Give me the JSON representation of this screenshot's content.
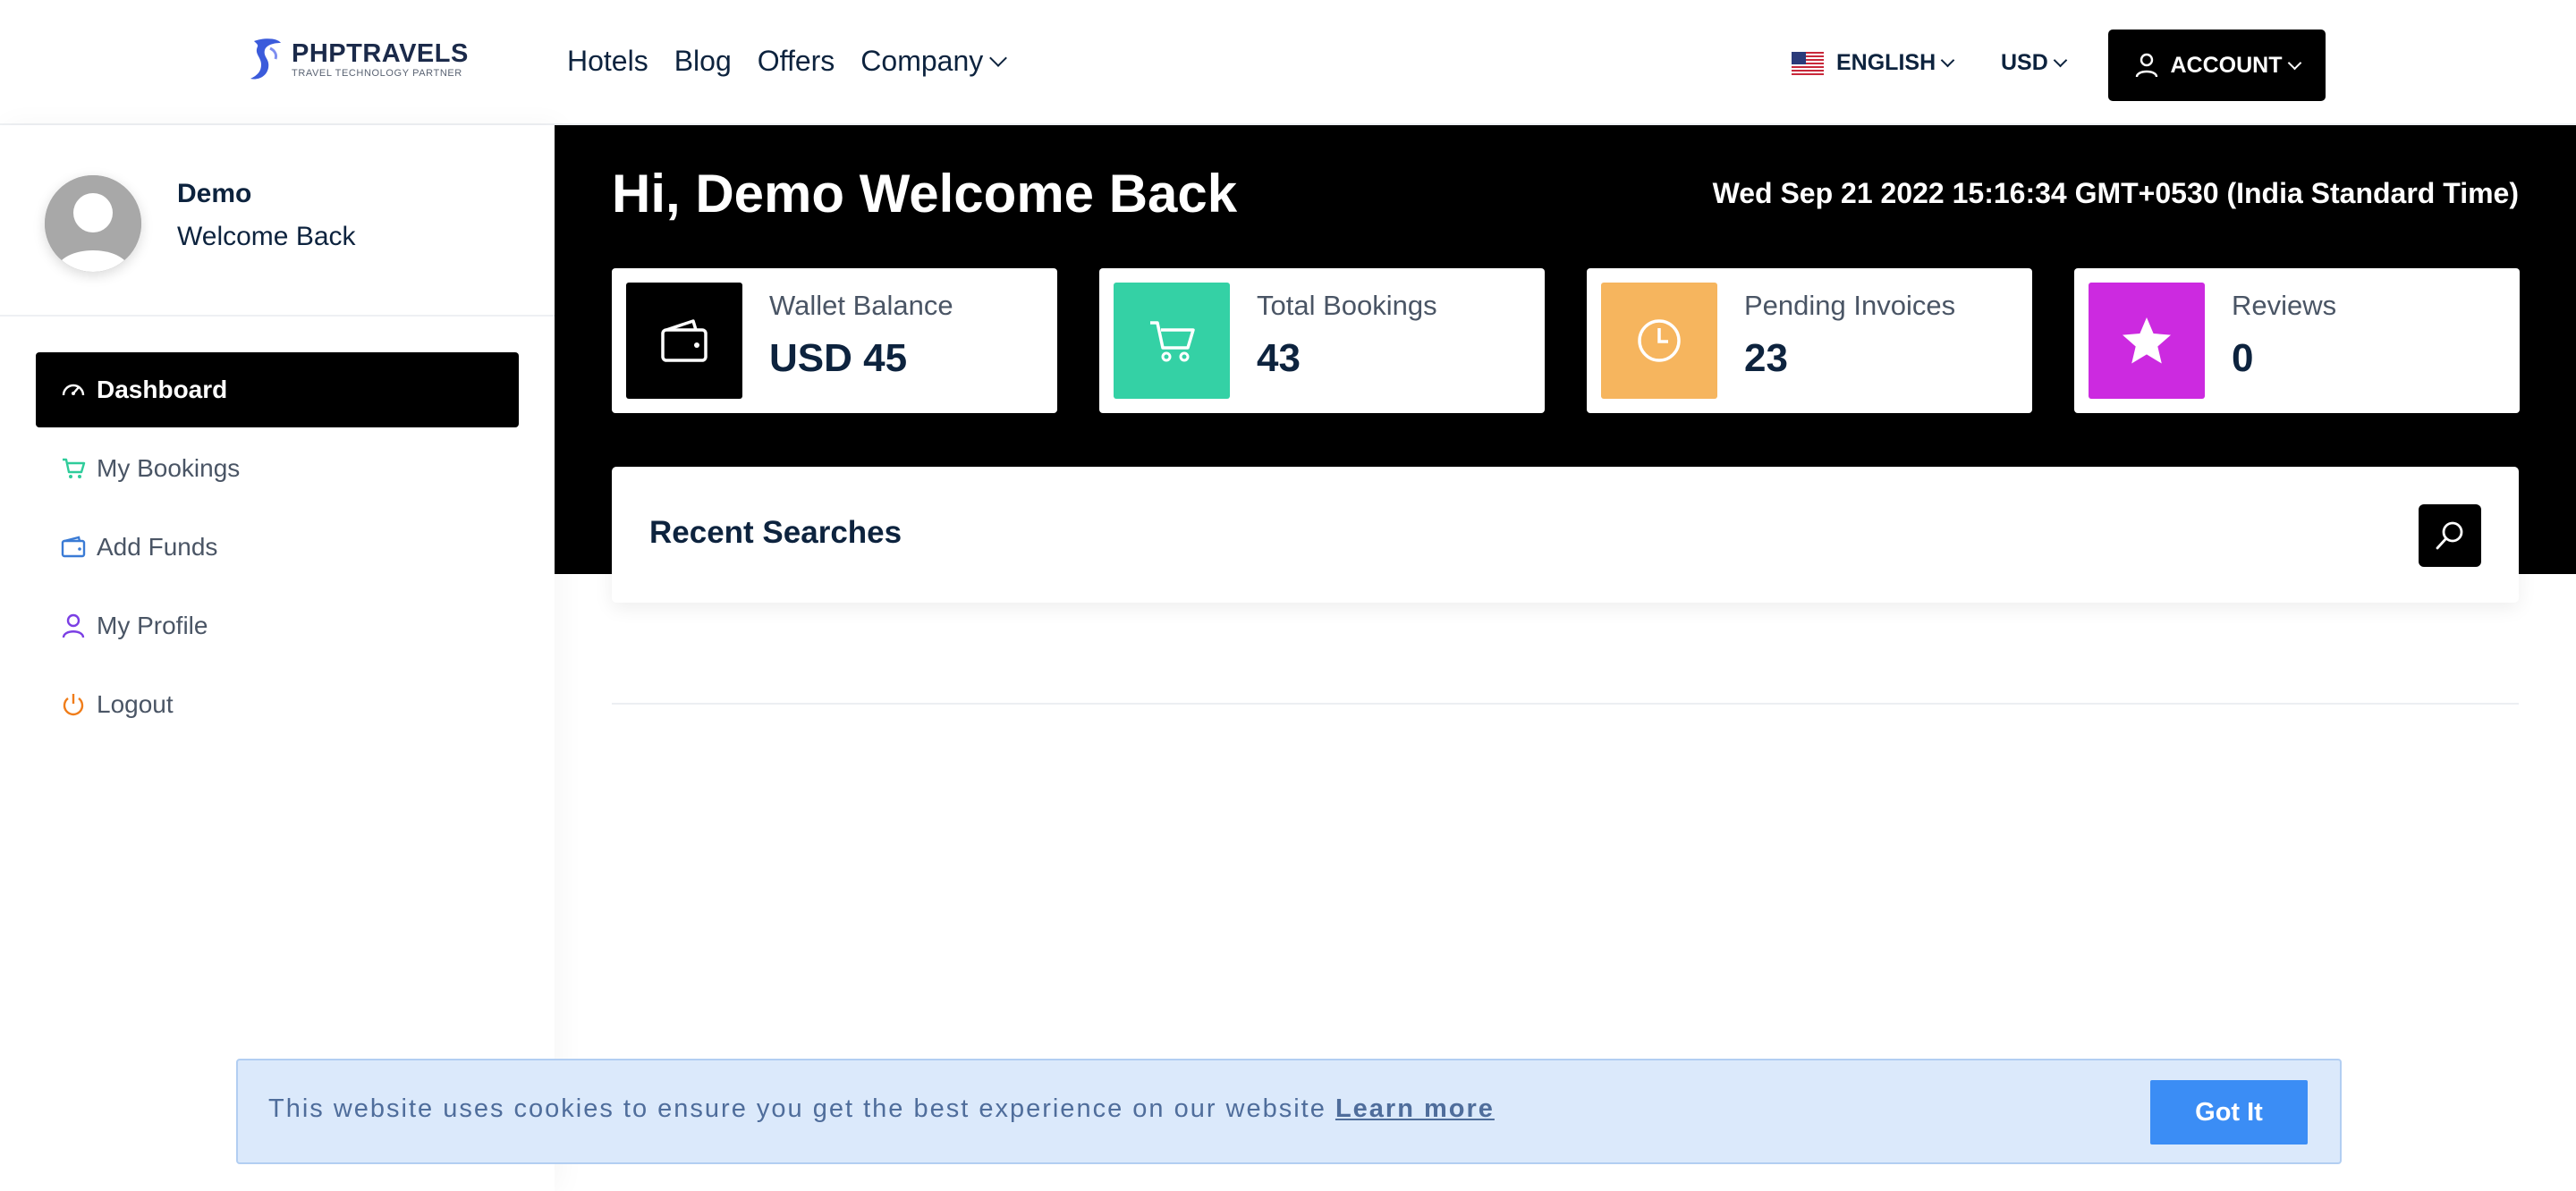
{
  "brand": {
    "name": "PHPTRAVELS",
    "tagline": "TRAVEL TECHNOLOGY PARTNER"
  },
  "nav": {
    "items": [
      "Hotels",
      "Blog",
      "Offers",
      "Company"
    ]
  },
  "header": {
    "language": "ENGLISH",
    "currency": "USD",
    "account_label": "ACCOUNT"
  },
  "profile": {
    "name": "Demo",
    "subtitle": "Welcome Back"
  },
  "sidebar": {
    "items": [
      {
        "label": "Dashboard",
        "icon": "speedometer-icon",
        "active": true
      },
      {
        "label": "My Bookings",
        "icon": "cart-icon",
        "color": "#2ecc9a"
      },
      {
        "label": "Add Funds",
        "icon": "wallet-icon",
        "color": "#3a7bd5"
      },
      {
        "label": "My Profile",
        "icon": "user-icon",
        "color": "#7b3fe4"
      },
      {
        "label": "Logout",
        "icon": "power-icon",
        "color": "#f07d1a"
      }
    ]
  },
  "dashboard": {
    "greeting": "Hi, Demo Welcome Back",
    "datetime": "Wed Sep 21 2022 15:16:34 GMT+0530 (India Standard Time)",
    "cards": [
      {
        "label": "Wallet Balance",
        "value": "USD 45",
        "icon": "wallet-icon",
        "color": "#000000"
      },
      {
        "label": "Total Bookings",
        "value": "43",
        "icon": "cart-icon",
        "color": "#34d1a5"
      },
      {
        "label": "Pending Invoices",
        "value": "23",
        "icon": "clock-icon",
        "color": "#f6b55e"
      },
      {
        "label": "Reviews",
        "value": "0",
        "icon": "star-icon",
        "color": "#cc2ae0"
      }
    ],
    "recent_searches_title": "Recent Searches"
  },
  "cookie": {
    "message": "This website uses cookies to ensure you get the best experience on our website",
    "link": "Learn more",
    "button": "Got It"
  }
}
